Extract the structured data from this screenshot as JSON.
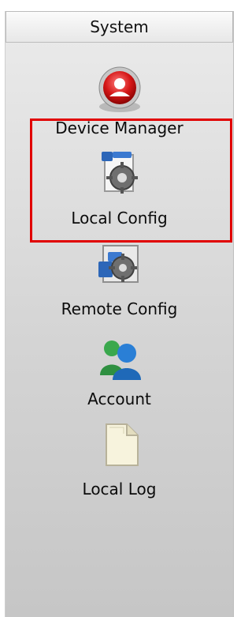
{
  "panel": {
    "header": "System",
    "items": [
      {
        "label": "Device Manager",
        "icon": "device-manager-icon"
      },
      {
        "label": "Local Config",
        "icon": "local-config-icon"
      },
      {
        "label": "Remote Config",
        "icon": "remote-config-icon"
      },
      {
        "label": "Account",
        "icon": "account-icon"
      },
      {
        "label": "Local Log",
        "icon": "local-log-icon"
      }
    ]
  },
  "colors": {
    "highlight": "#e10000",
    "device_manager_red": "#d41515",
    "account_green": "#3aa84d",
    "account_blue": "#2a7fd6"
  }
}
